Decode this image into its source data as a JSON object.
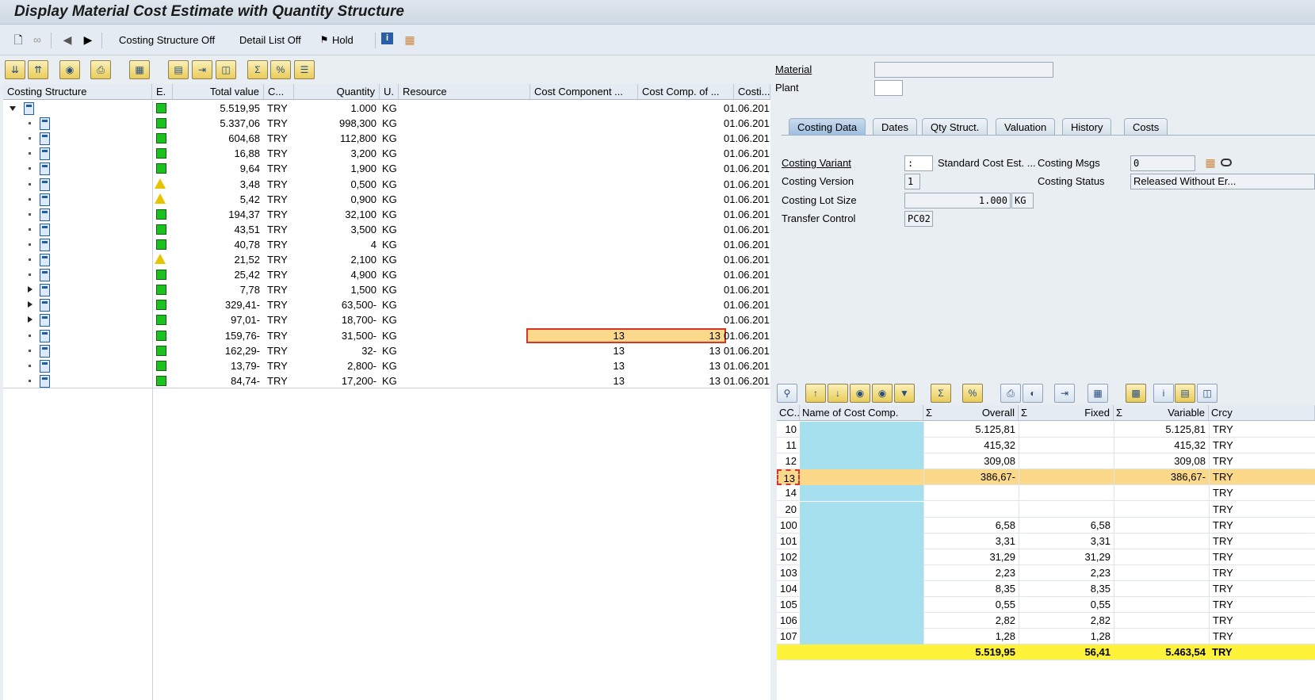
{
  "title": "Display Material Cost Estimate with Quantity Structure",
  "toolbar": {
    "new_icon": "new-document-icon",
    "glasses_icon": "glasses-icon",
    "prev_icon": "previous-icon",
    "next_icon": "next-icon",
    "costing_structure_off": "Costing Structure Off",
    "detail_list_off": "Detail List Off",
    "hold": "Hold"
  },
  "left_grid": {
    "headers": [
      "Costing Structure",
      "E.",
      "Total value",
      "C...",
      "Quantity",
      "U.",
      "Resource",
      "Cost Component ...",
      "Cost Comp. of ...",
      "Costi..."
    ],
    "rows": [
      {
        "expander": "down",
        "status": "green",
        "value": "5.519,95",
        "cur": "TRY",
        "qty": "1.000",
        "unit": "KG",
        "cc1": "",
        "cc2": "",
        "date": "01.06.201"
      },
      {
        "expander": "dot",
        "status": "green",
        "value": "5.337,06",
        "cur": "TRY",
        "qty": "998,300",
        "unit": "KG",
        "cc1": "",
        "cc2": "",
        "date": "01.06.201"
      },
      {
        "expander": "dot",
        "status": "green",
        "value": "604,68",
        "cur": "TRY",
        "qty": "112,800",
        "unit": "KG",
        "cc1": "",
        "cc2": "",
        "date": "01.06.201"
      },
      {
        "expander": "dot",
        "status": "green",
        "value": "16,88",
        "cur": "TRY",
        "qty": "3,200",
        "unit": "KG",
        "cc1": "",
        "cc2": "",
        "date": "01.06.201"
      },
      {
        "expander": "dot",
        "status": "green",
        "value": "9,64",
        "cur": "TRY",
        "qty": "1,900",
        "unit": "KG",
        "cc1": "",
        "cc2": "",
        "date": "01.06.201"
      },
      {
        "expander": "dot",
        "status": "warn",
        "value": "3,48",
        "cur": "TRY",
        "qty": "0,500",
        "unit": "KG",
        "cc1": "",
        "cc2": "",
        "date": "01.06.201"
      },
      {
        "expander": "dot",
        "status": "warn",
        "value": "5,42",
        "cur": "TRY",
        "qty": "0,900",
        "unit": "KG",
        "cc1": "",
        "cc2": "",
        "date": "01.06.201"
      },
      {
        "expander": "dot",
        "status": "green",
        "value": "194,37",
        "cur": "TRY",
        "qty": "32,100",
        "unit": "KG",
        "cc1": "",
        "cc2": "",
        "date": "01.06.201"
      },
      {
        "expander": "dot",
        "status": "green",
        "value": "43,51",
        "cur": "TRY",
        "qty": "3,500",
        "unit": "KG",
        "cc1": "",
        "cc2": "",
        "date": "01.06.201"
      },
      {
        "expander": "dot",
        "status": "green",
        "value": "40,78",
        "cur": "TRY",
        "qty": "4",
        "unit": "KG",
        "cc1": "",
        "cc2": "",
        "date": "01.06.201"
      },
      {
        "expander": "dot",
        "status": "warn",
        "value": "21,52",
        "cur": "TRY",
        "qty": "2,100",
        "unit": "KG",
        "cc1": "",
        "cc2": "",
        "date": "01.06.201"
      },
      {
        "expander": "dot",
        "status": "green",
        "value": "25,42",
        "cur": "TRY",
        "qty": "4,900",
        "unit": "KG",
        "cc1": "",
        "cc2": "",
        "date": "01.06.201"
      },
      {
        "expander": "right",
        "status": "green",
        "value": "7,78",
        "cur": "TRY",
        "qty": "1,500",
        "unit": "KG",
        "cc1": "",
        "cc2": "",
        "date": "01.06.201"
      },
      {
        "expander": "right",
        "status": "green",
        "value": "329,41-",
        "cur": "TRY",
        "qty": "63,500-",
        "unit": "KG",
        "cc1": "",
        "cc2": "",
        "date": "01.06.201"
      },
      {
        "expander": "right",
        "status": "green",
        "value": "97,01-",
        "cur": "TRY",
        "qty": "18,700-",
        "unit": "KG",
        "cc1": "",
        "cc2": "",
        "date": "01.06.201"
      },
      {
        "expander": "dot",
        "status": "green",
        "value": "159,76-",
        "cur": "TRY",
        "qty": "31,500-",
        "unit": "KG",
        "cc1": "13",
        "cc2": "13",
        "date": "01.06.201",
        "highlight": true
      },
      {
        "expander": "dot",
        "status": "green",
        "value": "162,29-",
        "cur": "TRY",
        "qty": "32-",
        "unit": "KG",
        "cc1": "13",
        "cc2": "13",
        "date": "01.06.201"
      },
      {
        "expander": "dot",
        "status": "green",
        "value": "13,79-",
        "cur": "TRY",
        "qty": "2,800-",
        "unit": "KG",
        "cc1": "13",
        "cc2": "13",
        "date": "01.06.201"
      },
      {
        "expander": "dot",
        "status": "green",
        "value": "84,74-",
        "cur": "TRY",
        "qty": "17,200-",
        "unit": "KG",
        "cc1": "13",
        "cc2": "13",
        "date": "01.06.201"
      }
    ]
  },
  "header_fields": {
    "material_label": "Material",
    "plant_label": "Plant"
  },
  "tabs": [
    "Costing Data",
    "Dates",
    "Qty Struct.",
    "Valuation",
    "History",
    "Costs"
  ],
  "costing_data": {
    "costing_variant_label": "Costing Variant",
    "costing_variant_value": ":",
    "costing_variant_text": "Standard Cost Est. ...",
    "costing_msgs_label": "Costing Msgs",
    "costing_msgs_value": "0",
    "costing_version_label": "Costing Version",
    "costing_version_value": "1",
    "costing_status_label": "Costing Status",
    "costing_status_value": "Released Without Er...",
    "lot_size_label": "Costing Lot Size",
    "lot_size_value": "1.000",
    "lot_size_unit": "KG",
    "transfer_label": "Transfer Control",
    "transfer_value": "PC02"
  },
  "bottom_grid": {
    "headers": [
      "CC..",
      "Name of Cost Comp.",
      "Σ",
      "Overall",
      "Σ",
      "Fixed",
      "Σ",
      "Variable",
      "Crcy"
    ],
    "rows": [
      {
        "cc": "10",
        "overall": "5.125,81",
        "fixed": "",
        "variable": "5.125,81",
        "crcy": "TRY"
      },
      {
        "cc": "11",
        "overall": "415,32",
        "fixed": "",
        "variable": "415,32",
        "crcy": "TRY"
      },
      {
        "cc": "12",
        "overall": "309,08",
        "fixed": "",
        "variable": "309,08",
        "crcy": "TRY"
      },
      {
        "cc": "13",
        "overall": "386,67-",
        "fixed": "",
        "variable": "386,67-",
        "crcy": "TRY",
        "highlight": true
      },
      {
        "cc": "14",
        "overall": "",
        "fixed": "",
        "variable": "",
        "crcy": "TRY"
      },
      {
        "cc": "20",
        "overall": "",
        "fixed": "",
        "variable": "",
        "crcy": "TRY"
      },
      {
        "cc": "100",
        "overall": "6,58",
        "fixed": "6,58",
        "variable": "",
        "crcy": "TRY"
      },
      {
        "cc": "101",
        "overall": "3,31",
        "fixed": "3,31",
        "variable": "",
        "crcy": "TRY"
      },
      {
        "cc": "102",
        "overall": "31,29",
        "fixed": "31,29",
        "variable": "",
        "crcy": "TRY"
      },
      {
        "cc": "103",
        "overall": "2,23",
        "fixed": "2,23",
        "variable": "",
        "crcy": "TRY"
      },
      {
        "cc": "104",
        "overall": "8,35",
        "fixed": "8,35",
        "variable": "",
        "crcy": "TRY"
      },
      {
        "cc": "105",
        "overall": "0,55",
        "fixed": "0,55",
        "variable": "",
        "crcy": "TRY"
      },
      {
        "cc": "106",
        "overall": "2,82",
        "fixed": "2,82",
        "variable": "",
        "crcy": "TRY"
      },
      {
        "cc": "107",
        "overall": "1,28",
        "fixed": "1,28",
        "variable": "",
        "crcy": "TRY"
      }
    ],
    "total": {
      "overall": "5.519,95",
      "fixed": "56,41",
      "variable": "5.463,54",
      "crcy": "TRY"
    }
  },
  "colors": {
    "highlight_row": "#fcd98a",
    "total_row": "#fff23a",
    "name_col": "#a6e0ef",
    "status_green": "#19c21c"
  }
}
